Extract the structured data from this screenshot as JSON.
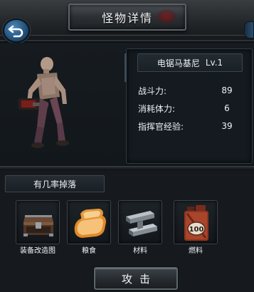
{
  "header": {
    "title": "怪物详情"
  },
  "monster": {
    "name": "电锯马基尼",
    "level": "Lv.1",
    "stats": [
      {
        "label": "战斗力:",
        "value": "89"
      },
      {
        "label": "消耗体力:",
        "value": "6"
      },
      {
        "label": "指挥官经验:",
        "value": "39"
      }
    ]
  },
  "drops": {
    "title": "有几率掉落",
    "items": [
      {
        "label": "装备改造图",
        "icon": "toolbox-icon"
      },
      {
        "label": "粮食",
        "icon": "bread-icon"
      },
      {
        "label": "材料",
        "icon": "steel-beam-icon"
      },
      {
        "label": "燃料",
        "icon": "fuel-can-icon"
      }
    ],
    "fuel_badge": "100"
  },
  "actions": {
    "attack_label": "攻击"
  },
  "colors": {
    "back_button": "#2e6a9c",
    "blood_stain": "#8c1414",
    "panel_border": "#2f3b44"
  }
}
